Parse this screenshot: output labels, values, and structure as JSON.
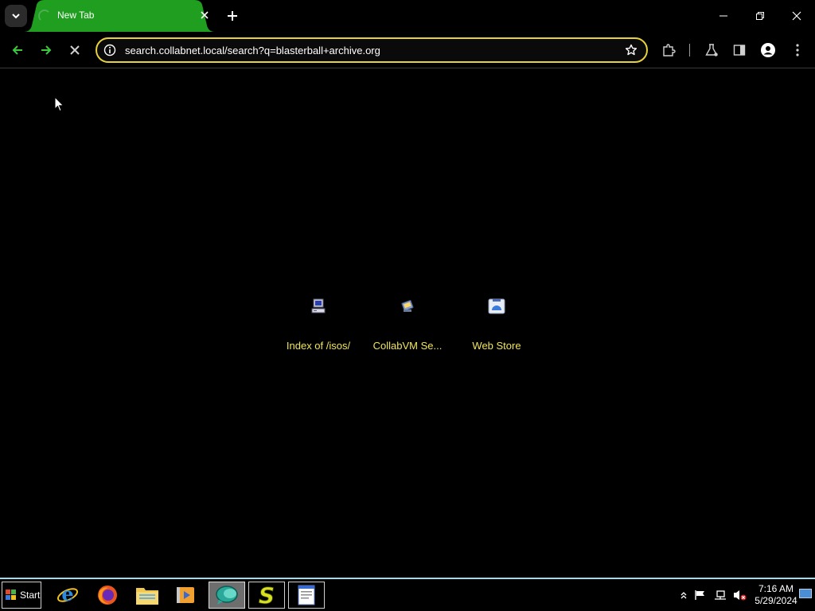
{
  "browser": {
    "tab": {
      "title": "New Tab"
    },
    "address_bar": {
      "url": "search.collabnet.local/search?q=blasterball+archive.org"
    }
  },
  "content": {
    "shortcuts": [
      {
        "label": "Index of /isos/",
        "icon": "computer-icon"
      },
      {
        "label": "CollabVM Se...",
        "icon": "collabvm-icon"
      },
      {
        "label": "Web Store",
        "icon": "web-store-icon"
      }
    ]
  },
  "taskbar": {
    "start_label": "Start",
    "apps": [
      {
        "name": "internet-explorer",
        "icon": "internet-explorer-icon"
      },
      {
        "name": "firefox",
        "icon": "firefox-icon"
      },
      {
        "name": "file-explorer",
        "icon": "folder-icon"
      },
      {
        "name": "media-player",
        "icon": "media-player-icon"
      },
      {
        "name": "chat-app",
        "icon": "chat-bubble-icon"
      },
      {
        "name": "s-app",
        "icon": "s-letter-icon"
      },
      {
        "name": "wordpad",
        "icon": "document-icon"
      }
    ],
    "clock": {
      "time": "7:16 AM",
      "date": "5/29/2024"
    }
  },
  "colors": {
    "tab_active": "#1f9e1f",
    "omnibox_border": "#e6d23a",
    "shortcut_label": "#f0e45a",
    "nav_arrow": "#3cc83c",
    "taskbar_border": "#a9d8e8"
  }
}
